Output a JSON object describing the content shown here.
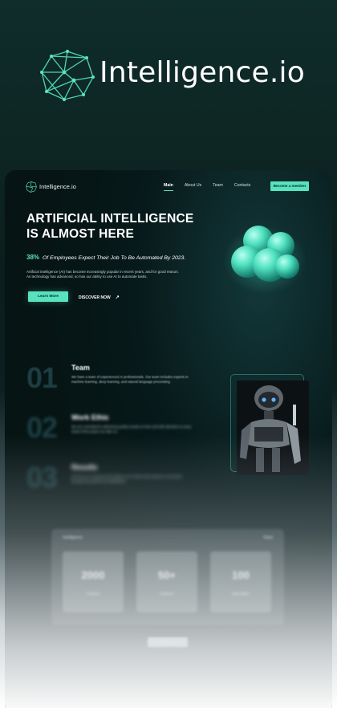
{
  "brand": {
    "name": "Intelligence.io"
  },
  "nav": {
    "brand": "Intelligence.io",
    "links": [
      "Main",
      "About Us",
      "Team",
      "Contacts"
    ],
    "cta": "Become a member"
  },
  "hero": {
    "title_line1": "ARTIFICIAL INTELLIGENCE",
    "title_line2": "IS ALMOST HERE",
    "stat_percent": "38%",
    "stat_text": "Of Employees Expect Their Job To Be Automated By 2023.",
    "description": "Artificial intelligence (AI) has become increasingly popular in recent years, and for good reason. As technology has advanced, so has our ability to use AI to automate tasks.",
    "learn_more": "Learn More",
    "discover": "DISCOVER NOW",
    "discover_icon": "arrow-up-right-icon"
  },
  "sections": [
    {
      "num": "01",
      "title": "Team",
      "desc": "We have a team of experienced AI professionals. Our team includes experts in machine learning, deep learning, and natural language processing."
    },
    {
      "num": "02",
      "title": "Work Ethic",
      "desc": "We are committed to delivering quality results on time and with attention to every detail of the project we take on."
    },
    {
      "num": "03",
      "title": "Results",
      "desc": "We focus on outcomes that matter to our clients and measure our success through their growth and satisfaction."
    }
  ],
  "stats_panel": {
    "left_label": "Intelligence",
    "right_label": "Team",
    "cards": [
      {
        "value": "2000",
        "caption": "Projects"
      },
      {
        "value": "50+",
        "caption": "Partners"
      },
      {
        "value": "100",
        "caption": "Specialists"
      }
    ],
    "bottom_button": "Contact us"
  },
  "colors": {
    "accent": "#58e2bd",
    "background": "#0b1d1c"
  }
}
